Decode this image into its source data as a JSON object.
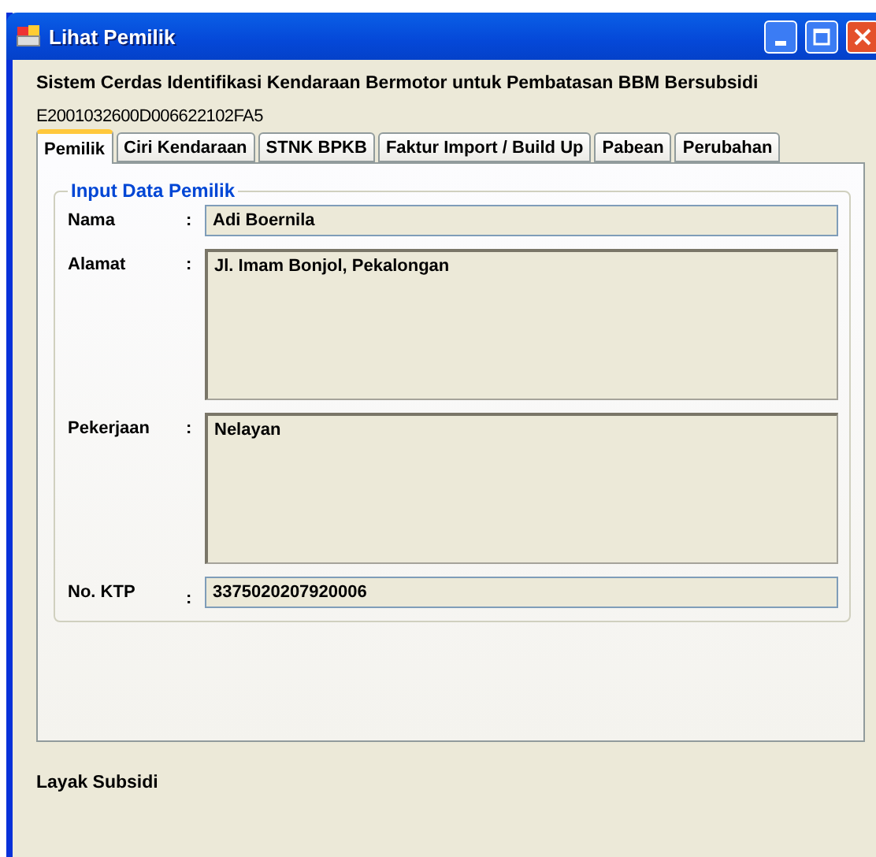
{
  "window": {
    "title": "Lihat Pemilik"
  },
  "heading": "Sistem Cerdas Identifikasi Kendaraan Bermotor untuk Pembatasan BBM Bersubsidi",
  "tag_id": "E2001032600D006622102FA5",
  "tabs": [
    {
      "label": "Pemilik",
      "selected": true
    },
    {
      "label": "Ciri Kendaraan",
      "selected": false
    },
    {
      "label": "STNK BPKB",
      "selected": false
    },
    {
      "label": "Faktur Import / Build Up",
      "selected": false
    },
    {
      "label": "Pabean",
      "selected": false
    },
    {
      "label": "Perubahan",
      "selected": false
    }
  ],
  "group": {
    "title": "Input Data Pemilik",
    "fields": [
      {
        "label": "Nama",
        "colon": ":",
        "kind": "line",
        "value": "Adi Boernila"
      },
      {
        "label": "Alamat",
        "colon": ":",
        "kind": "multiline",
        "value": "Jl. Imam Bonjol, Pekalongan"
      },
      {
        "label": "Pekerjaan",
        "colon": ":",
        "kind": "multiline",
        "value": "Nelayan"
      },
      {
        "label": "No. KTP",
        "colon": ":",
        "kind": "line",
        "value": "3375020207920006"
      }
    ]
  },
  "status": "Layak Subsidi"
}
